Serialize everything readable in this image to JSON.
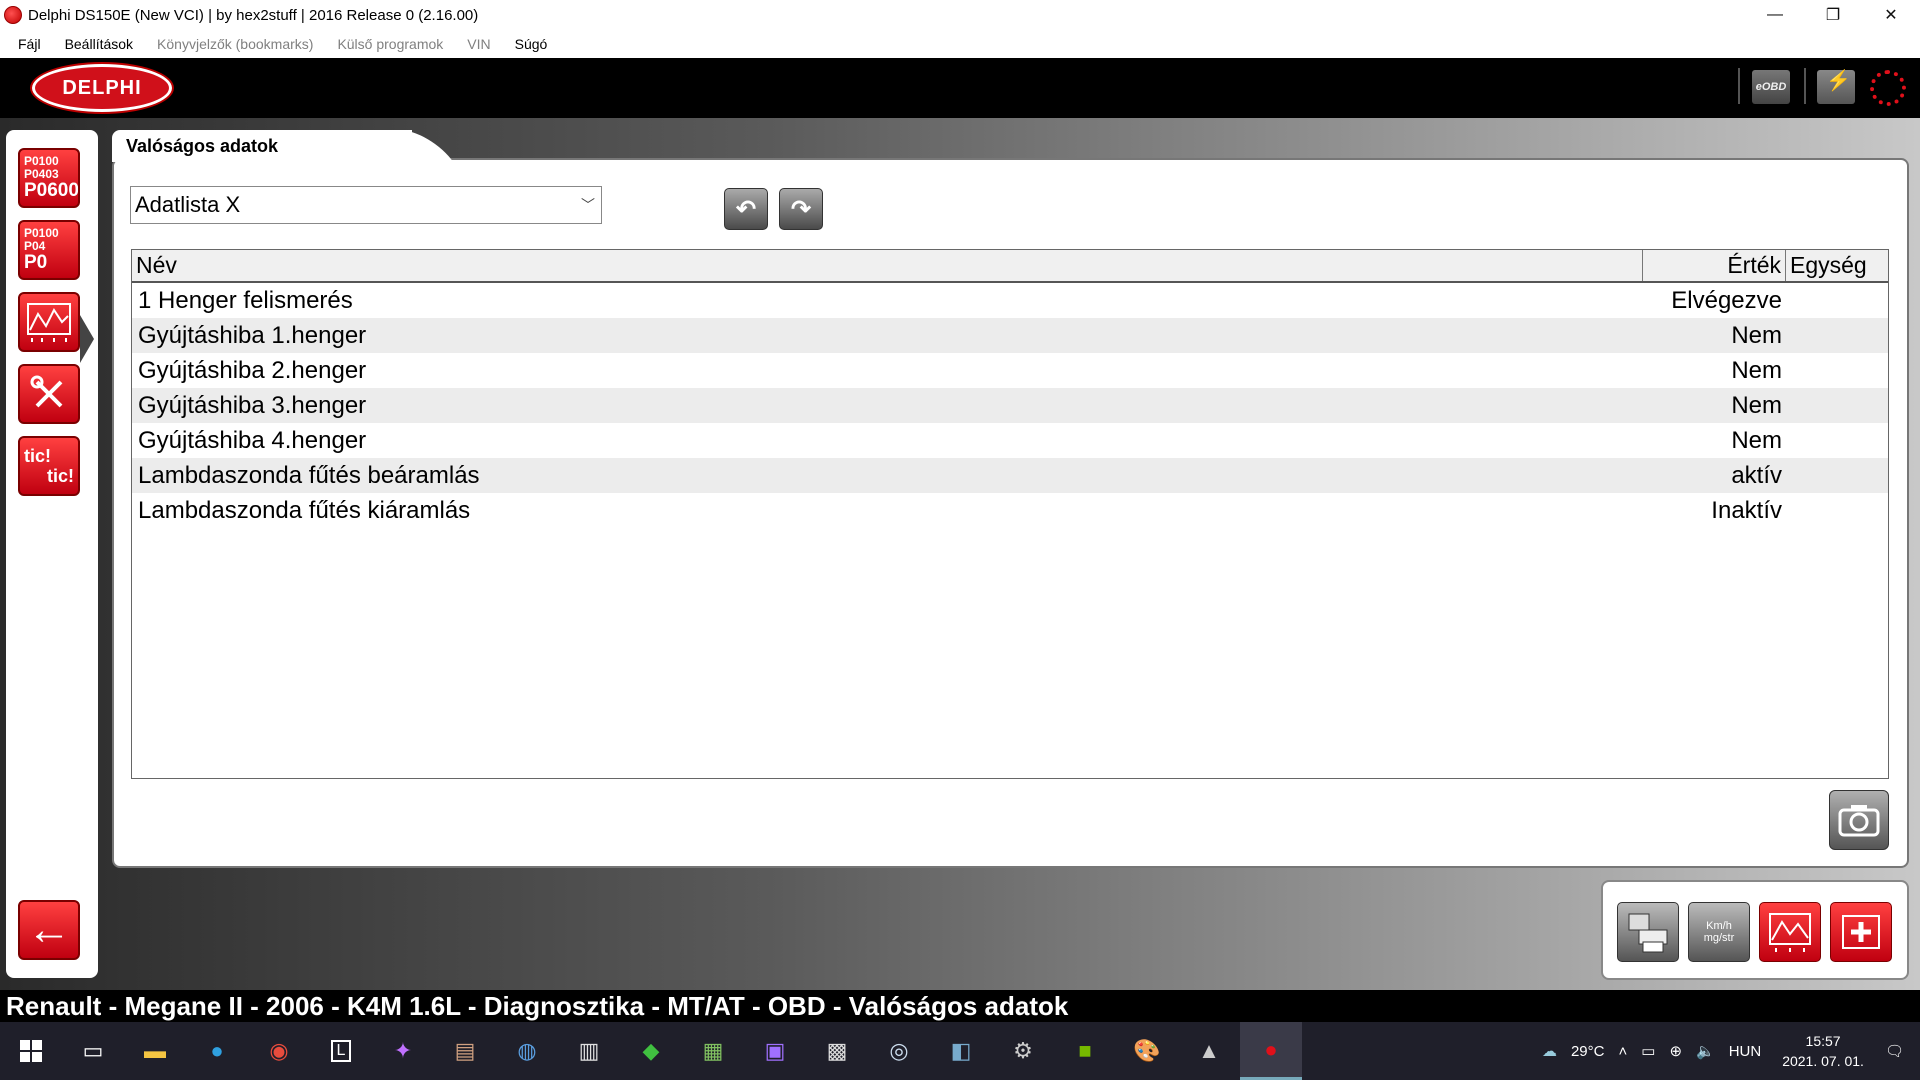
{
  "window": {
    "title": "Delphi DS150E (New VCI) | by hex2stuff | 2016 Release 0 (2.16.00)",
    "minimize": "—",
    "maximize": "❐",
    "close": "✕"
  },
  "menu": [
    {
      "label": "Fájl",
      "enabled": true
    },
    {
      "label": "Beállítások",
      "enabled": true
    },
    {
      "label": "Könyvjelzők (bookmarks)",
      "enabled": false
    },
    {
      "label": "Külső programok",
      "enabled": false
    },
    {
      "label": "VIN",
      "enabled": false
    },
    {
      "label": "Súgó",
      "enabled": true
    }
  ],
  "header": {
    "logo": "DELPHI",
    "eobd": "eOBD"
  },
  "sidebar": {
    "dtc_codes": [
      "P0100",
      "P0403",
      "P0600"
    ],
    "dtc_clear_codes": [
      "P0100",
      "P04",
      "P0"
    ],
    "tictic": [
      "tic!",
      "tic!"
    ],
    "back": "←"
  },
  "panel": {
    "tab_label": "Valóságos adatok",
    "select_value": "Adatlista X",
    "nav_back": "↶",
    "nav_forward": "↷"
  },
  "table": {
    "columns": {
      "name": "Név",
      "value": "Érték",
      "unit": "Egység"
    },
    "rows": [
      {
        "name": "1 Henger felismerés",
        "value": "Elvégezve",
        "unit": ""
      },
      {
        "name": "Gyújtáshiba 1.henger",
        "value": "Nem",
        "unit": ""
      },
      {
        "name": "Gyújtáshiba 2.henger",
        "value": "Nem",
        "unit": ""
      },
      {
        "name": "Gyújtáshiba 3.henger",
        "value": "Nem",
        "unit": ""
      },
      {
        "name": "Gyújtáshiba 4.henger",
        "value": "Nem",
        "unit": ""
      },
      {
        "name": "Lambdaszonda fűtés beáramlás",
        "value": "aktív",
        "unit": ""
      },
      {
        "name": "Lambdaszonda fűtés kiáramlás",
        "value": "Inaktív",
        "unit": ""
      }
    ]
  },
  "toolbar": {
    "units_label": "Km/h mg/str"
  },
  "status": {
    "text": "Renault - Megane II - 2006 - K4M 1.6L - Diagnosztika - MT/AT - OBD - Valóságos adatok"
  },
  "taskbar": {
    "weather": "29°C",
    "language": "HUN",
    "time": "15:57",
    "date": "2021. 07. 01."
  },
  "colors": {
    "accent_red": "#d0101a",
    "header_black": "#000000",
    "status_black": "#000000"
  }
}
